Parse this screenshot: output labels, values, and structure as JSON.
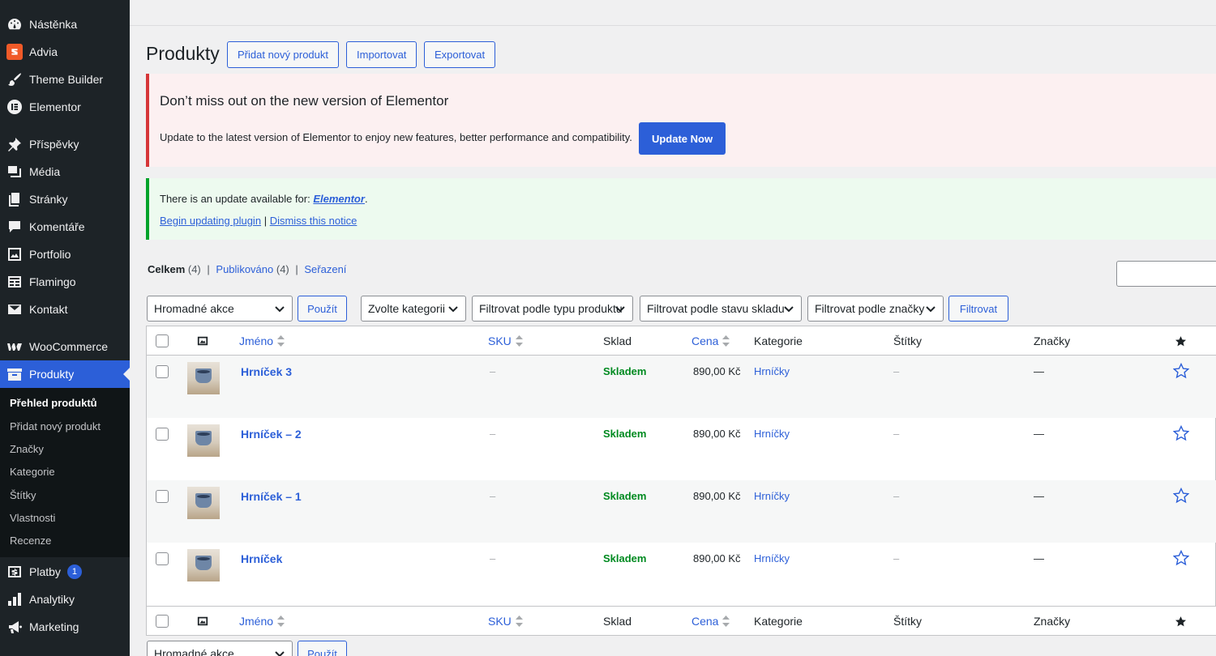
{
  "sidebar": {
    "items": [
      {
        "label": "Nástěnka",
        "icon": "dashboard-icon"
      },
      {
        "label": "Advia",
        "icon": "advia-icon"
      },
      {
        "label": "Theme Builder",
        "icon": "brush-icon"
      },
      {
        "label": "Elementor",
        "icon": "elementor-icon"
      },
      {
        "label": "Příspěvky",
        "icon": "pin-icon"
      },
      {
        "label": "Média",
        "icon": "media-icon"
      },
      {
        "label": "Stránky",
        "icon": "pages-icon"
      },
      {
        "label": "Komentáře",
        "icon": "comment-icon"
      },
      {
        "label": "Portfolio",
        "icon": "portfolio-icon"
      },
      {
        "label": "Flamingo",
        "icon": "flamingo-icon"
      },
      {
        "label": "Kontakt",
        "icon": "mail-icon"
      },
      {
        "label": "WooCommerce",
        "icon": "woo-icon"
      },
      {
        "label": "Produkty",
        "icon": "archive-icon"
      },
      {
        "label": "Platby",
        "icon": "money-icon",
        "badge": "1"
      },
      {
        "label": "Analytiky",
        "icon": "chart-icon"
      },
      {
        "label": "Marketing",
        "icon": "megaphone-icon"
      }
    ],
    "submenu": [
      "Přehled produktů",
      "Přidat nový produkt",
      "Značky",
      "Kategorie",
      "Štítky",
      "Vlastnosti",
      "Recenze"
    ]
  },
  "header": {
    "title": "Produkty",
    "add_new": "Přidat nový produkt",
    "import": "Importovat",
    "export": "Exportovat"
  },
  "notice_elementor": {
    "heading": "Don’t miss out on the new version of Elementor",
    "text": "Update to the latest version of Elementor to enjoy new features, better performance and compatibility.",
    "button": "Update Now"
  },
  "notice_update": {
    "prefix": "There is an update available for:",
    "plugin": "Elementor",
    "suffix": ".",
    "begin": "Begin updating plugin",
    "sep": "|",
    "dismiss": "Dismiss this notice"
  },
  "views": {
    "all": "Celkem",
    "all_count": "(4)",
    "published": "Publikováno",
    "published_count": "(4)",
    "sorting": "Seřazení",
    "sep": "|"
  },
  "filters": {
    "bulk_top": "Hromadné akce",
    "apply": "Použít",
    "category": "Zvolte kategorii",
    "type": "Filtrovat podle typu produktu",
    "stock": "Filtrovat podle stavu skladu",
    "brand": "Filtrovat podle značky",
    "filter_btn": "Filtrovat",
    "bulk_bottom": "Hromadné akce"
  },
  "table": {
    "columns": {
      "name": "Jméno",
      "sku": "SKU",
      "stock": "Sklad",
      "price": "Cena",
      "category": "Kategorie",
      "tags": "Štítky",
      "brands": "Značky"
    },
    "rows": [
      {
        "name": "Hrníček 3",
        "sku": "–",
        "stock": "Skladem",
        "price": "890,00 Kč",
        "category": "Hrníčky",
        "tags": "–",
        "brands": "—"
      },
      {
        "name": "Hrníček – 2",
        "sku": "–",
        "stock": "Skladem",
        "price": "890,00 Kč",
        "category": "Hrníčky",
        "tags": "–",
        "brands": "—"
      },
      {
        "name": "Hrníček – 1",
        "sku": "–",
        "stock": "Skladem",
        "price": "890,00 Kč",
        "category": "Hrníčky",
        "tags": "–",
        "brands": "—"
      },
      {
        "name": "Hrníček",
        "sku": "–",
        "stock": "Skladem",
        "price": "890,00 Kč",
        "category": "Hrníčky",
        "tags": "–",
        "brands": "—"
      }
    ]
  },
  "colors": {
    "accent": "#2c5fd8",
    "sidebar_bg": "#1d2327",
    "in_stock": "#008a20",
    "notice_error": "#d63638",
    "notice_success": "#00a32a"
  }
}
